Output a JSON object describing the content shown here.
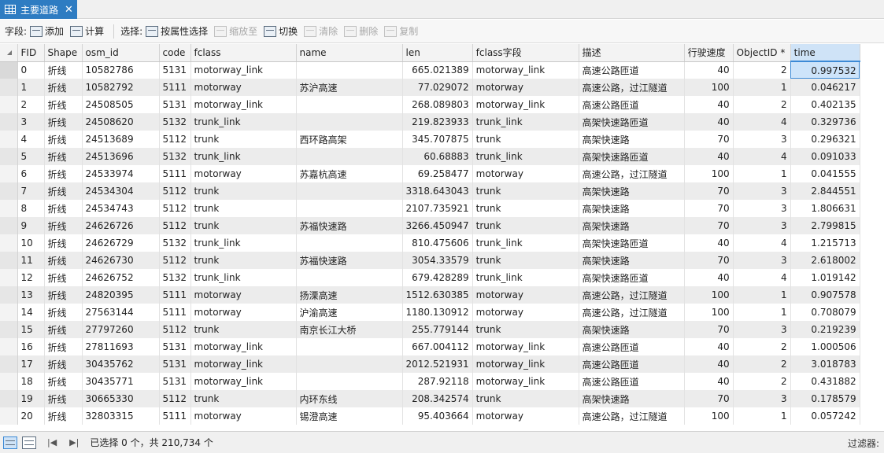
{
  "tab": {
    "title": "主要道路",
    "close": "✕"
  },
  "toolbar": {
    "fields_label": "字段:",
    "add": "添加",
    "calculate": "计算",
    "selection_label": "选择:",
    "select_by_attr": "按属性选择",
    "zoom_to": "缩放至",
    "switch": "切换",
    "clear": "清除",
    "delete": "删除",
    "copy": "复制"
  },
  "table": {
    "headers": [
      "FID",
      "Shape",
      "osm_id",
      "code",
      "fclass",
      "name",
      "len",
      "fclass字段",
      "描述",
      "行驶速度",
      "ObjectID *",
      "time"
    ],
    "rows": [
      [
        "0",
        "折线",
        "10582786",
        "5131",
        "motorway_link",
        "",
        "665.021389",
        "motorway_link",
        "高速公路匝道",
        "40",
        "2",
        "0.997532"
      ],
      [
        "1",
        "折线",
        "10582792",
        "5111",
        "motorway",
        "苏沪高速",
        "77.029072",
        "motorway",
        "高速公路，过江隧道",
        "100",
        "1",
        "0.046217"
      ],
      [
        "2",
        "折线",
        "24508505",
        "5131",
        "motorway_link",
        "",
        "268.089803",
        "motorway_link",
        "高速公路匝道",
        "40",
        "2",
        "0.402135"
      ],
      [
        "3",
        "折线",
        "24508620",
        "5132",
        "trunk_link",
        "",
        "219.823933",
        "trunk_link",
        "高架快速路匝道",
        "40",
        "4",
        "0.329736"
      ],
      [
        "4",
        "折线",
        "24513689",
        "5112",
        "trunk",
        "西环路高架",
        "345.707875",
        "trunk",
        "高架快速路",
        "70",
        "3",
        "0.296321"
      ],
      [
        "5",
        "折线",
        "24513696",
        "5132",
        "trunk_link",
        "",
        "60.68883",
        "trunk_link",
        "高架快速路匝道",
        "40",
        "4",
        "0.091033"
      ],
      [
        "6",
        "折线",
        "24533974",
        "5111",
        "motorway",
        "苏嘉杭高速",
        "69.258477",
        "motorway",
        "高速公路，过江隧道",
        "100",
        "1",
        "0.041555"
      ],
      [
        "7",
        "折线",
        "24534304",
        "5112",
        "trunk",
        "",
        "3318.643043",
        "trunk",
        "高架快速路",
        "70",
        "3",
        "2.844551"
      ],
      [
        "8",
        "折线",
        "24534743",
        "5112",
        "trunk",
        "",
        "2107.735921",
        "trunk",
        "高架快速路",
        "70",
        "3",
        "1.806631"
      ],
      [
        "9",
        "折线",
        "24626726",
        "5112",
        "trunk",
        "苏福快速路",
        "3266.450947",
        "trunk",
        "高架快速路",
        "70",
        "3",
        "2.799815"
      ],
      [
        "10",
        "折线",
        "24626729",
        "5132",
        "trunk_link",
        "",
        "810.475606",
        "trunk_link",
        "高架快速路匝道",
        "40",
        "4",
        "1.215713"
      ],
      [
        "11",
        "折线",
        "24626730",
        "5112",
        "trunk",
        "苏福快速路",
        "3054.33579",
        "trunk",
        "高架快速路",
        "70",
        "3",
        "2.618002"
      ],
      [
        "12",
        "折线",
        "24626752",
        "5132",
        "trunk_link",
        "",
        "679.428289",
        "trunk_link",
        "高架快速路匝道",
        "40",
        "4",
        "1.019142"
      ],
      [
        "13",
        "折线",
        "24820395",
        "5111",
        "motorway",
        "扬溧高速",
        "1512.630385",
        "motorway",
        "高速公路，过江隧道",
        "100",
        "1",
        "0.907578"
      ],
      [
        "14",
        "折线",
        "27563144",
        "5111",
        "motorway",
        "沪渝高速",
        "1180.130912",
        "motorway",
        "高速公路，过江隧道",
        "100",
        "1",
        "0.708079"
      ],
      [
        "15",
        "折线",
        "27797260",
        "5112",
        "trunk",
        "南京长江大桥",
        "255.779144",
        "trunk",
        "高架快速路",
        "70",
        "3",
        "0.219239"
      ],
      [
        "16",
        "折线",
        "27811693",
        "5131",
        "motorway_link",
        "",
        "667.004112",
        "motorway_link",
        "高速公路匝道",
        "40",
        "2",
        "1.000506"
      ],
      [
        "17",
        "折线",
        "30435762",
        "5131",
        "motorway_link",
        "",
        "2012.521931",
        "motorway_link",
        "高速公路匝道",
        "40",
        "2",
        "3.018783"
      ],
      [
        "18",
        "折线",
        "30435771",
        "5131",
        "motorway_link",
        "",
        "287.92118",
        "motorway_link",
        "高速公路匝道",
        "40",
        "2",
        "0.431882"
      ],
      [
        "19",
        "折线",
        "30665330",
        "5112",
        "trunk",
        "内环东线",
        "208.342574",
        "trunk",
        "高架快速路",
        "70",
        "3",
        "0.178579"
      ],
      [
        "20",
        "折线",
        "32803315",
        "5111",
        "motorway",
        "锡澄高速",
        "95.403664",
        "motorway",
        "高速公路，过江隧道",
        "100",
        "1",
        "0.057242"
      ]
    ]
  },
  "status": {
    "first": "|◀",
    "last": "▶|",
    "selection_text": "已选择 0 个，共 210,734 个",
    "filter_label": "过滤器:"
  }
}
